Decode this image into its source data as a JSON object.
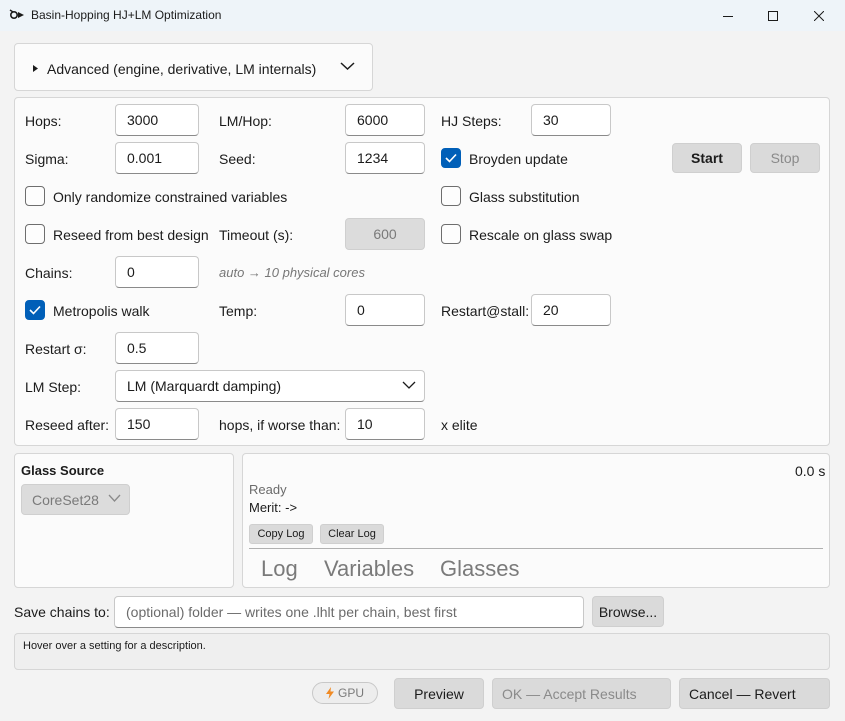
{
  "window": {
    "title": "Basin-Hopping HJ+LM Optimization"
  },
  "expander": {
    "label": "Advanced (engine, derivative, LM internals)"
  },
  "settings": {
    "hops_label": "Hops:",
    "hops_value": "3000",
    "lm_hop_label": "LM/Hop:",
    "lm_hop_value": "6000",
    "hj_steps_label": "HJ Steps:",
    "hj_steps_value": "30",
    "sigma_label": "Sigma:",
    "sigma_value": "0.001",
    "seed_label": "Seed:",
    "seed_value": "1234",
    "broyden_label": "Broyden update",
    "broyden_checked": true,
    "start_label": "Start",
    "stop_label": "Stop",
    "only_randomize_label": "Only randomize constrained variables",
    "only_randomize_checked": false,
    "glass_sub_label": "Glass substitution",
    "glass_sub_checked": false,
    "reseed_best_label": "Reseed from best design",
    "reseed_best_checked": false,
    "timeout_label": "Timeout (s):",
    "timeout_value": "600",
    "rescale_label": "Rescale on glass swap",
    "rescale_checked": false,
    "chains_label": "Chains:",
    "chains_value": "0",
    "chains_hint": "auto → 10 physical cores",
    "metropolis_label": "Metropolis walk",
    "metropolis_checked": true,
    "temp_label": "Temp:",
    "temp_value": "0",
    "restart_stall_label": "Restart@stall:",
    "restart_stall_value": "20",
    "restart_sigma_label": "Restart σ:",
    "restart_sigma_value": "0.5",
    "lm_step_label": "LM Step:",
    "lm_step_value": "LM (Marquardt damping)",
    "reseed_after_label": "Reseed after:",
    "reseed_after_value": "150",
    "worse_than_label": "hops, if worse than:",
    "worse_than_value": "10",
    "elite_label": "x elite"
  },
  "glass_source": {
    "title": "Glass Source",
    "selected": "CoreSet28"
  },
  "log_panel": {
    "elapsed": "0.0 s",
    "status": "Ready",
    "merit": "Merit:  ->",
    "copy_log": "Copy Log",
    "clear_log": "Clear Log",
    "tabs": [
      "Log",
      "Variables",
      "Glasses"
    ]
  },
  "save_chains": {
    "label": "Save chains to:",
    "placeholder": "(optional) folder — writes one .lhlt per chain, best first",
    "browse": "Browse..."
  },
  "status_bar": {
    "text": "Hover over a setting for a description."
  },
  "footer": {
    "gpu": "GPU",
    "preview": "Preview",
    "ok": "OK — Accept Results",
    "cancel": "Cancel — Revert"
  },
  "colors": {
    "accent": "#005fb8",
    "titlebar": "#eef4f9",
    "gpu_bolt": "#f08a24"
  }
}
